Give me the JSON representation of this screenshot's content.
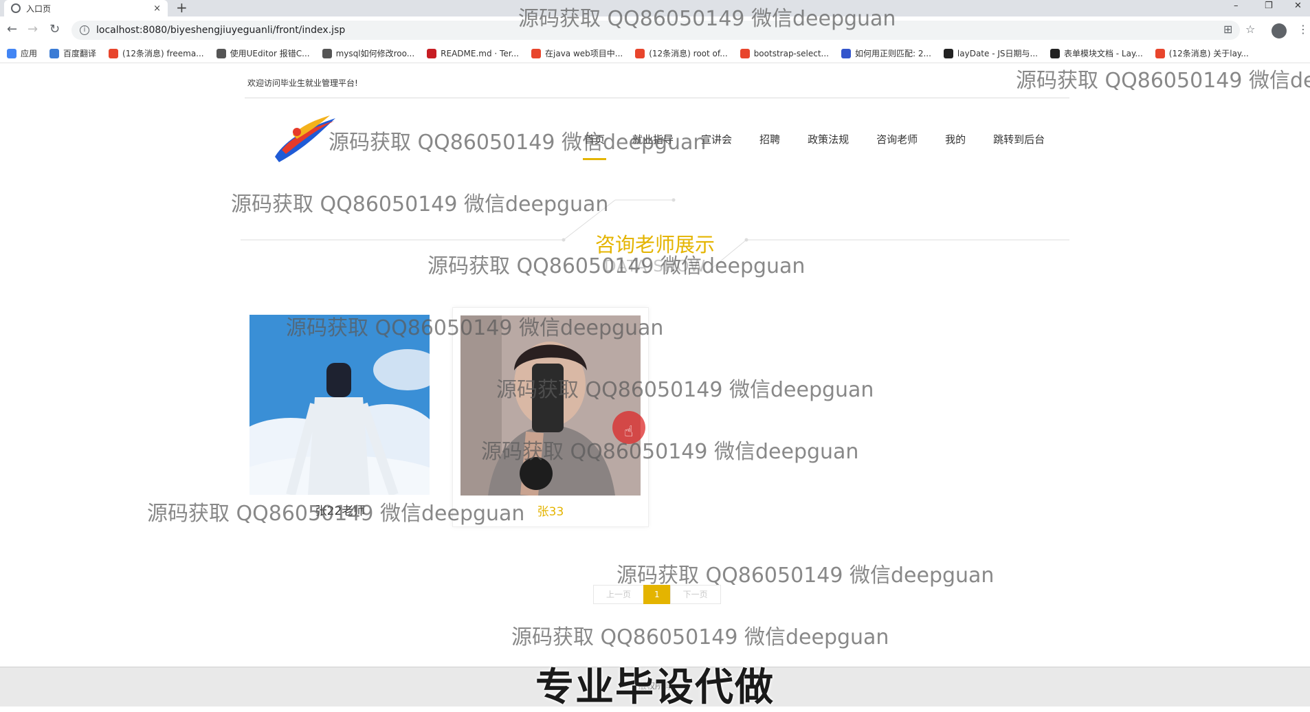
{
  "browser": {
    "tab_title": "入口页",
    "tab_close": "×",
    "new_tab": "+",
    "url": "localhost:8080/biyeshengjiuyeguanli/front/index.jsp",
    "window_controls": [
      "–",
      "❐",
      "✕"
    ],
    "bookmarks": [
      {
        "label": "应用",
        "icon": "apps-grid-icon",
        "color": "#4285f4"
      },
      {
        "label": "百度翻译",
        "icon": "translate-icon",
        "color": "#3a7bd5"
      },
      {
        "label": "(12条消息) freema...",
        "icon": "csdn-icon",
        "color": "#e8452c"
      },
      {
        "label": "使用UEditor 报错C...",
        "icon": "link-icon",
        "color": "#555555"
      },
      {
        "label": "mysql如何修改roo...",
        "icon": "link-icon",
        "color": "#555555"
      },
      {
        "label": "README.md · Ter...",
        "icon": "gitee-icon",
        "color": "#c71d23"
      },
      {
        "label": "在java web项目中...",
        "icon": "csdn-icon",
        "color": "#e8452c"
      },
      {
        "label": "(12条消息) root of...",
        "icon": "csdn-icon",
        "color": "#e8452c"
      },
      {
        "label": "bootstrap-select...",
        "icon": "bookmark-icon",
        "color": "#e8452c"
      },
      {
        "label": "如何用正则匹配: 2...",
        "icon": "paw-icon",
        "color": "#3355cc"
      },
      {
        "label": "layDate - JS日期与...",
        "icon": "layui-icon",
        "color": "#222222"
      },
      {
        "label": "表单模块文档 - Lay...",
        "icon": "layui-icon",
        "color": "#222222"
      },
      {
        "label": "(12条消息) 关于lay...",
        "icon": "csdn-icon",
        "color": "#e8452c"
      }
    ]
  },
  "site": {
    "welcome": "欢迎访问毕业生就业管理平台!",
    "nav": [
      "首页",
      "就业指导",
      "宣讲会",
      "招聘",
      "政策法规",
      "咨询老师",
      "我的",
      "跳转到后台"
    ],
    "active_nav": "首页",
    "accent_color": "#e4b400"
  },
  "section": {
    "title": "咨询老师展示",
    "subtitle": "DATA SHOW"
  },
  "teachers": [
    {
      "name": "张22老师"
    },
    {
      "name": "张33"
    }
  ],
  "pagination": {
    "prev": "上一页",
    "current": "1",
    "next": "下一页"
  },
  "footer": {
    "text": "版权所有",
    "banner": "专业毕设代做"
  },
  "watermark": "源码获取 QQ86050149 微信deepguan"
}
